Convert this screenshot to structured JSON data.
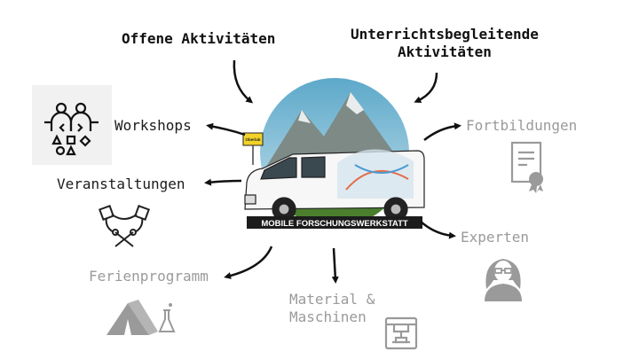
{
  "header": {
    "open_activities": "Offene Aktivitäten",
    "school_activities_line1": "Unterrichtsbegleitende",
    "school_activities_line2": "Aktivitäten"
  },
  "items": {
    "workshops": "Workshops",
    "events": "Veranstaltungen",
    "holiday": "Ferienprogramm",
    "material_line1": "Material &",
    "material_line2": "Maschinen",
    "training": "Fortbildungen",
    "experts": "Experten"
  },
  "van": {
    "banner": "MOBILE FORSCHUNGSWERKSTATT",
    "sign": "Oberlab"
  },
  "colors": {
    "sky": "#79b9d6",
    "mountain": "#7d8a86",
    "hill": "#5f9a3d",
    "banner": "#1c1c1c",
    "gray_item": "#9a9a9a"
  }
}
